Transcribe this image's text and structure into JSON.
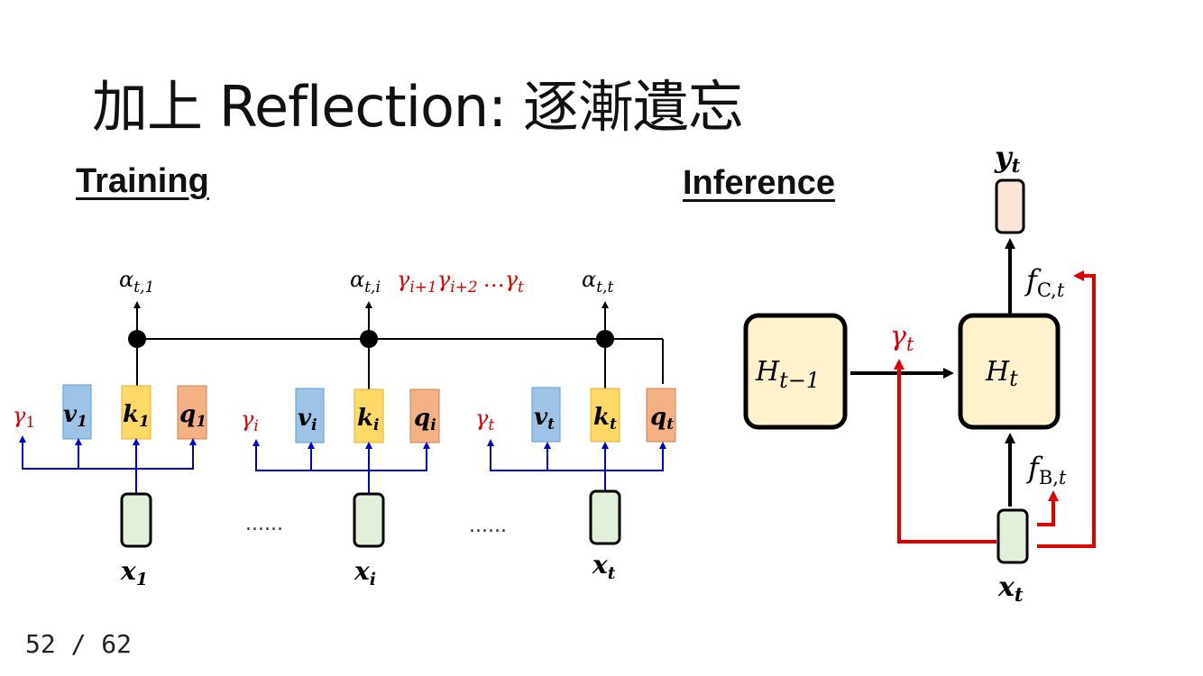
{
  "slide": {
    "title": "加上 Reflection: 逐漸遺忘",
    "page": "52 / 62"
  },
  "training": {
    "heading": "Training",
    "ellipsis": "......",
    "alpha_label_1": "α",
    "alpha_sub_1": "t,1",
    "alpha_label_i": "α",
    "alpha_sub_i": "t,i",
    "alpha_label_t": "α",
    "alpha_sub_t": "t,t",
    "gamma_product": {
      "g1": "γ",
      "s1": "i+1",
      "g2": "γ",
      "s2": "i+2",
      "dots": "…",
      "g3": "γ",
      "s3": "t"
    },
    "groups": [
      {
        "gamma": "γ",
        "gamma_sub": "1",
        "v": "v",
        "k": "k",
        "q": "q",
        "sub": "1",
        "x": "x",
        "x_sub": "1"
      },
      {
        "gamma": "γ",
        "gamma_sub": "i",
        "v": "v",
        "k": "k",
        "q": "q",
        "sub": "i",
        "x": "x",
        "x_sub": "i"
      },
      {
        "gamma": "γ",
        "gamma_sub": "t",
        "v": "v",
        "k": "k",
        "q": "q",
        "sub": "t",
        "x": "x",
        "x_sub": "t"
      }
    ]
  },
  "inference": {
    "heading": "Inference",
    "y": "y",
    "y_sub": "t",
    "h_prev": "H",
    "h_prev_sub": "t−1",
    "h_cur": "H",
    "h_cur_sub": "t",
    "gamma": "γ",
    "gamma_sub": "t",
    "f_c": "f",
    "f_c_sub": "C,",
    "f_b": "f",
    "f_b_sub": "B,",
    "x": "x",
    "x_sub": "t"
  },
  "colors": {
    "blue_box": "#9dc3e6",
    "yellow_box": "#ffd966",
    "orange_box": "#f4b183",
    "green_box": "#e2f0d9",
    "h_box": "#fff2cc",
    "y_box": "#fbe5d6",
    "red": "#e00000",
    "blue_line": "#0000cc"
  }
}
